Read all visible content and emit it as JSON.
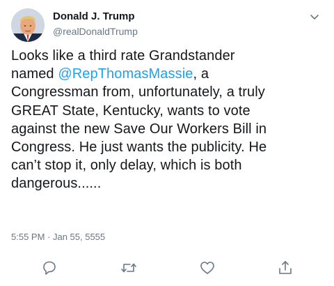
{
  "tweet": {
    "author_name": "Donald J. Trump",
    "author_handle": "@realDonaldTrump",
    "text_lines": [
      {
        "before": "Looks like a third rate Grandstander",
        "mention": "",
        "after": ""
      },
      {
        "before": "named ",
        "mention": "@RepThomasMassie",
        "after": ", a"
      },
      {
        "before": "Congressman from, unfortunately, a truly",
        "mention": "",
        "after": ""
      },
      {
        "before": "GREAT State, Kentucky, wants to vote",
        "mention": "",
        "after": ""
      },
      {
        "before": "against the new Save Our Workers Bill in",
        "mention": "",
        "after": ""
      },
      {
        "before": "Congress. He just wants the publicity. He",
        "mention": "",
        "after": ""
      },
      {
        "before": "can’t stop it, only delay, which is both",
        "mention": "",
        "after": ""
      },
      {
        "before": "dangerous......",
        "mention": "",
        "after": ""
      }
    ],
    "timestamp": "5:55 PM · Jan 55, 5555"
  },
  "actions": {
    "reply_icon": "reply-icon",
    "retweet_icon": "retweet-icon",
    "like_icon": "heart-icon",
    "share_icon": "share-icon"
  },
  "colors": {
    "text": "#14171a",
    "secondary": "#657786",
    "link": "#1da1f2"
  }
}
